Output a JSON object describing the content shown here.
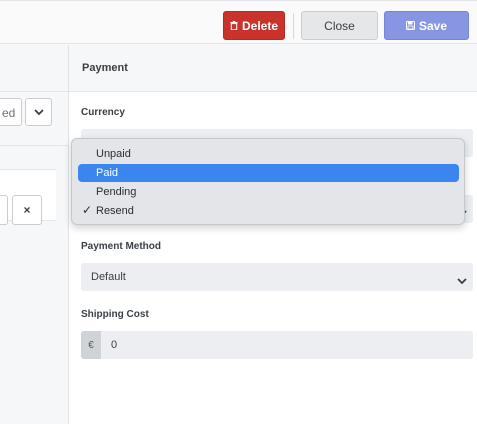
{
  "toolbar": {
    "delete_label": "Delete",
    "close_label": "Close",
    "save_label": "Save"
  },
  "left": {
    "select_value": "ed",
    "remove_label": "×"
  },
  "panel": {
    "title": "Payment",
    "currency_label": "Currency",
    "payment_method_label": "Payment Method",
    "payment_method_value": "Default",
    "shipping_cost_label": "Shipping Cost",
    "currency_symbol": "€",
    "shipping_cost_value": "0"
  },
  "dropdown": {
    "options": [
      "Unpaid",
      "Paid",
      "Pending",
      "Resend"
    ],
    "highlighted": "Paid",
    "checked": "Resend"
  },
  "colors": {
    "delete": "#c9332b",
    "save": "#8796e3",
    "highlight": "#3a85ee"
  }
}
